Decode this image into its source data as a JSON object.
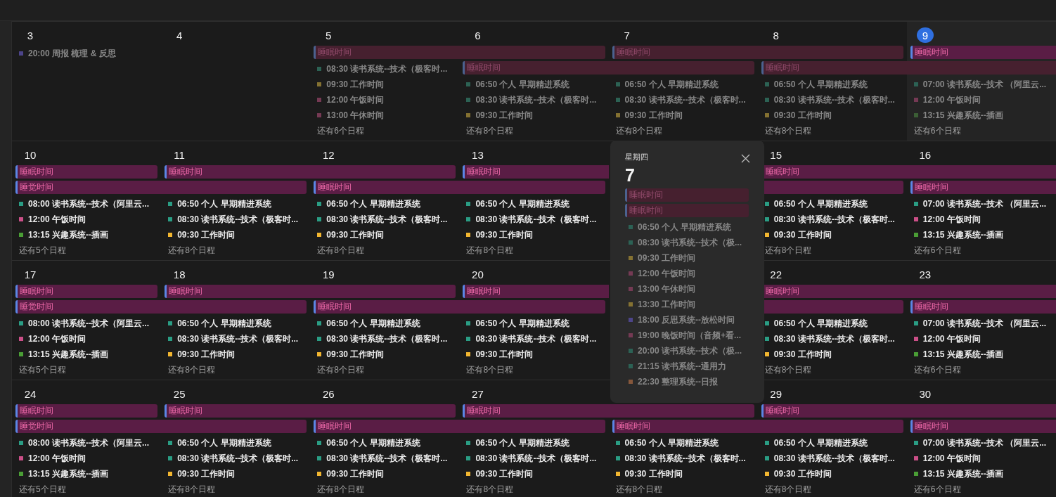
{
  "weeks": [
    {
      "days": [
        {
          "kind": "day",
          "day": "3",
          "today": false,
          "dimmed": true,
          "events": [
            {
              "text": "20:00 周报 梳理 & 反思",
              "color": "#4f4790"
            }
          ]
        },
        {
          "kind": "day",
          "day": "4",
          "today": false
        },
        {
          "kind": "day",
          "day": "5",
          "today": false,
          "dimmed": true,
          "lanes": [
            {
              "label": "睡眠时间",
              "starts": true,
              "ends": false,
              "dimmed": true
            }
          ],
          "events": [
            {
              "text": "08:30 读书系统--技术（极客时...",
              "color": "#2d6658"
            },
            {
              "text": "09:30 工作时间",
              "color": "#8a7633"
            },
            {
              "text": "12:00 午饭时间",
              "color": "#7a3b57"
            },
            {
              "text": "13:00 午休时间",
              "color": "#7a3b57"
            }
          ],
          "more": "还有6个日程"
        },
        {
          "kind": "day",
          "day": "6",
          "today": false,
          "dimmed": true,
          "lanes": [
            {
              "starts": false,
              "ends": true,
              "dimmed": true
            },
            {
              "label": "睡眠时间",
              "starts": true,
              "ends": false,
              "dimmed": true
            }
          ],
          "events": [
            {
              "text": "06:50 个人 早期精进系统",
              "color": "#2d6658"
            },
            {
              "text": "08:30 读书系统--技术（极客时...",
              "color": "#2d6658"
            },
            {
              "text": "09:30 工作时间",
              "color": "#8a7633"
            }
          ],
          "more": "还有8个日程"
        },
        {
          "kind": "day",
          "day": "7",
          "today": false,
          "dimmed": true,
          "lanes": [
            {
              "label": "睡眠时间",
              "starts": true,
              "ends": false,
              "dimmed": true
            },
            {
              "starts": false,
              "ends": true,
              "dimmed": true
            }
          ],
          "events": [
            {
              "text": "06:50 个人 早期精进系统",
              "color": "#2d6658"
            },
            {
              "text": "08:30 读书系统--技术（极客时...",
              "color": "#2d6658"
            },
            {
              "text": "09:30 工作时间",
              "color": "#8a7633"
            }
          ],
          "more": "还有8个日程"
        },
        {
          "kind": "day",
          "day": "8",
          "today": false,
          "dimmed": true,
          "lanes": [
            {
              "starts": false,
              "ends": true,
              "dimmed": true
            },
            {
              "label": "睡眠时间",
              "starts": true,
              "ends": false,
              "dimmed": true
            }
          ],
          "events": [
            {
              "text": "06:50 个人 早期精进系统",
              "color": "#2d6658"
            },
            {
              "text": "08:30 读书系统--技术（极客时...",
              "color": "#2d6658"
            },
            {
              "text": "09:30 工作时间",
              "color": "#8a7633"
            }
          ],
          "more": "还有8个日程"
        },
        {
          "kind": "day",
          "day": "9",
          "today": true,
          "dimmed": true,
          "lanes": [
            {
              "label": "睡眠时间",
              "starts": true,
              "ends": false,
              "dimmed": false
            },
            {
              "starts": false,
              "ends": false,
              "dimmed": true
            }
          ],
          "events": [
            {
              "text": "07:00 读书系统--技术 （阿里云...",
              "color": "#2d6658"
            },
            {
              "text": "12:00 午饭时间",
              "color": "#7a3b57"
            },
            {
              "text": "13:15 兴趣系统--插画",
              "color": "#3d6236"
            }
          ],
          "more": "还有6个日程"
        }
      ]
    },
    {
      "days": [
        {
          "kind": "day",
          "day": "10",
          "today": false,
          "dimmed": false,
          "lanes": [
            {
              "label": "睡眠时间",
              "starts": true,
              "ends": true,
              "dimmed": false
            },
            {
              "label": "睡觉时间",
              "starts": true,
              "ends": false,
              "dimmed": false
            }
          ],
          "events": [
            {
              "text": "08:00 读书系统--技术（阿里云...",
              "color": "#2a9d84"
            },
            {
              "text": "12:00 午饭时间",
              "color": "#cc4f88"
            },
            {
              "text": "13:15 兴趣系统--插画",
              "color": "#4a9e35"
            }
          ],
          "more": "还有5个日程"
        },
        {
          "kind": "day",
          "day": "11",
          "today": false,
          "dimmed": false,
          "lanes": [
            {
              "label": "睡眠时间",
              "starts": true,
              "ends": false,
              "dimmed": false
            },
            {
              "starts": false,
              "ends": true,
              "dimmed": false
            }
          ],
          "events": [
            {
              "text": "06:50 个人 早期精进系统",
              "color": "#2a9d84"
            },
            {
              "text": "08:30 读书系统--技术（极客时...",
              "color": "#2a9d84"
            },
            {
              "text": "09:30 工作时间",
              "color": "#f2b630"
            }
          ],
          "more": "还有8个日程"
        },
        {
          "kind": "day",
          "day": "12",
          "today": false,
          "dimmed": false,
          "lanes": [
            {
              "starts": false,
              "ends": true,
              "dimmed": false
            },
            {
              "label": "睡眠时间",
              "starts": true,
              "ends": false,
              "dimmed": false
            }
          ],
          "events": [
            {
              "text": "06:50 个人 早期精进系统",
              "color": "#2a9d84"
            },
            {
              "text": "08:30 读书系统--技术（极客时...",
              "color": "#2a9d84"
            },
            {
              "text": "09:30 工作时间",
              "color": "#f2b630"
            }
          ],
          "more": "还有8个日程"
        },
        {
          "kind": "day",
          "day": "13",
          "today": false,
          "dimmed": false,
          "lanes": [
            {
              "label": "睡眠时间",
              "starts": true,
              "ends": false,
              "dimmed": false
            },
            {
              "starts": false,
              "ends": true,
              "dimmed": false
            }
          ],
          "events": [
            {
              "text": "06:50 个人 早期精进系统",
              "color": "#2a9d84"
            },
            {
              "text": "08:30 读书系统--技术（极客时...",
              "color": "#2a9d84"
            },
            {
              "text": "09:30 工作时间",
              "color": "#f2b630"
            }
          ],
          "more": "还有8个日程"
        },
        {
          "kind": "covered"
        },
        {
          "kind": "day",
          "day": "15",
          "today": false,
          "dimmed": false,
          "lanes": [
            {
              "label": "睡眠时间",
              "starts": true,
              "ends": false,
              "dimmed": false
            },
            {
              "starts": false,
              "ends": true,
              "dimmed": false
            }
          ],
          "events": [
            {
              "text": "06:50 个人 早期精进系统",
              "color": "#2a9d84"
            },
            {
              "text": "08:30 读书系统--技术（极客时...",
              "color": "#2a9d84"
            },
            {
              "text": "09:30 工作时间",
              "color": "#f2b630"
            }
          ],
          "more": "还有8个日程"
        },
        {
          "kind": "day",
          "day": "16",
          "today": false,
          "dimmed": false,
          "lanes": [
            {
              "starts": false,
              "ends": false,
              "dimmed": false
            },
            {
              "label": "睡眠时间",
              "starts": true,
              "ends": false,
              "dimmed": false
            }
          ],
          "events": [
            {
              "text": "07:00 读书系统--技术 （阿里云...",
              "color": "#2a9d84"
            },
            {
              "text": "12:00 午饭时间",
              "color": "#cc4f88"
            },
            {
              "text": "13:15 兴趣系统--插画",
              "color": "#4a9e35"
            }
          ],
          "more": "还有6个日程"
        }
      ]
    },
    {
      "days": [
        {
          "kind": "day",
          "day": "17",
          "today": false,
          "dimmed": false,
          "lanes": [
            {
              "label": "睡眠时间",
              "starts": true,
              "ends": true,
              "dimmed": false
            },
            {
              "label": "睡觉时间",
              "starts": true,
              "ends": false,
              "dimmed": false
            }
          ],
          "events": [
            {
              "text": "08:00 读书系统--技术（阿里云...",
              "color": "#2a9d84"
            },
            {
              "text": "12:00 午饭时间",
              "color": "#cc4f88"
            },
            {
              "text": "13:15 兴趣系统--插画",
              "color": "#4a9e35"
            }
          ],
          "more": "还有5个日程"
        },
        {
          "kind": "day",
          "day": "18",
          "today": false,
          "dimmed": false,
          "lanes": [
            {
              "label": "睡眠时间",
              "starts": true,
              "ends": false,
              "dimmed": false
            },
            {
              "starts": false,
              "ends": true,
              "dimmed": false
            }
          ],
          "events": [
            {
              "text": "06:50 个人 早期精进系统",
              "color": "#2a9d84"
            },
            {
              "text": "08:30 读书系统--技术（极客时...",
              "color": "#2a9d84"
            },
            {
              "text": "09:30 工作时间",
              "color": "#f2b630"
            }
          ],
          "more": "还有8个日程"
        },
        {
          "kind": "day",
          "day": "19",
          "today": false,
          "dimmed": false,
          "lanes": [
            {
              "starts": false,
              "ends": true,
              "dimmed": false
            },
            {
              "label": "睡眠时间",
              "starts": true,
              "ends": false,
              "dimmed": false
            }
          ],
          "events": [
            {
              "text": "06:50 个人 早期精进系统",
              "color": "#2a9d84"
            },
            {
              "text": "08:30 读书系统--技术（极客时...",
              "color": "#2a9d84"
            },
            {
              "text": "09:30 工作时间",
              "color": "#f2b630"
            }
          ],
          "more": "还有8个日程"
        },
        {
          "kind": "day",
          "day": "20",
          "today": false,
          "dimmed": false,
          "lanes": [
            {
              "label": "睡眠时间",
              "starts": true,
              "ends": false,
              "dimmed": false
            },
            {
              "starts": false,
              "ends": true,
              "dimmed": false
            }
          ],
          "events": [
            {
              "text": "06:50 个人 早期精进系统",
              "color": "#2a9d84"
            },
            {
              "text": "08:30 读书系统--技术（极客时...",
              "color": "#2a9d84"
            },
            {
              "text": "09:30 工作时间",
              "color": "#f2b630"
            }
          ],
          "more": "还有8个日程"
        },
        {
          "kind": "covered"
        },
        {
          "kind": "day",
          "day": "22",
          "today": false,
          "dimmed": false,
          "lanes": [
            {
              "label": "睡眠时间",
              "starts": true,
              "ends": false,
              "dimmed": false
            },
            {
              "starts": false,
              "ends": true,
              "dimmed": false
            }
          ],
          "events": [
            {
              "text": "06:50 个人 早期精进系统",
              "color": "#2a9d84"
            },
            {
              "text": "08:30 读书系统--技术（极客时...",
              "color": "#2a9d84"
            },
            {
              "text": "09:30 工作时间",
              "color": "#f2b630"
            }
          ],
          "more": "还有8个日程"
        },
        {
          "kind": "day",
          "day": "23",
          "today": false,
          "dimmed": false,
          "lanes": [
            {
              "starts": false,
              "ends": false,
              "dimmed": false
            },
            {
              "label": "睡眠时间",
              "starts": true,
              "ends": false,
              "dimmed": false
            }
          ],
          "events": [
            {
              "text": "07:00 读书系统--技术 （阿里云...",
              "color": "#2a9d84"
            },
            {
              "text": "12:00 午饭时间",
              "color": "#cc4f88"
            },
            {
              "text": "13:15 兴趣系统--插画",
              "color": "#4a9e35"
            }
          ],
          "more": "还有6个日程"
        }
      ]
    },
    {
      "days": [
        {
          "kind": "day",
          "day": "24",
          "today": false,
          "dimmed": false,
          "lanes": [
            {
              "label": "睡眠时间",
              "starts": true,
              "ends": true,
              "dimmed": false
            },
            {
              "label": "睡觉时间",
              "starts": true,
              "ends": false,
              "dimmed": false
            }
          ],
          "events": [
            {
              "text": "08:00 读书系统--技术（阿里云...",
              "color": "#2a9d84"
            },
            {
              "text": "12:00 午饭时间",
              "color": "#cc4f88"
            },
            {
              "text": "13:15 兴趣系统--插画",
              "color": "#4a9e35"
            }
          ],
          "more": "还有5个日程"
        },
        {
          "kind": "day",
          "day": "25",
          "today": false,
          "dimmed": false,
          "lanes": [
            {
              "label": "睡眠时间",
              "starts": true,
              "ends": false,
              "dimmed": false
            },
            {
              "starts": false,
              "ends": true,
              "dimmed": false
            }
          ],
          "events": [
            {
              "text": "06:50 个人 早期精进系统",
              "color": "#2a9d84"
            },
            {
              "text": "08:30 读书系统--技术（极客时...",
              "color": "#2a9d84"
            },
            {
              "text": "09:30 工作时间",
              "color": "#f2b630"
            }
          ],
          "more": "还有8个日程"
        },
        {
          "kind": "day",
          "day": "26",
          "today": false,
          "dimmed": false,
          "lanes": [
            {
              "starts": false,
              "ends": true,
              "dimmed": false
            },
            {
              "label": "睡眠时间",
              "starts": true,
              "ends": false,
              "dimmed": false
            }
          ],
          "events": [
            {
              "text": "06:50 个人 早期精进系统",
              "color": "#2a9d84"
            },
            {
              "text": "08:30 读书系统--技术（极客时...",
              "color": "#2a9d84"
            },
            {
              "text": "09:30 工作时间",
              "color": "#f2b630"
            }
          ],
          "more": "还有8个日程"
        },
        {
          "kind": "day",
          "day": "27",
          "today": false,
          "dimmed": false,
          "lanes": [
            {
              "label": "睡眠时间",
              "starts": true,
              "ends": false,
              "dimmed": false
            },
            {
              "starts": false,
              "ends": true,
              "dimmed": false
            }
          ],
          "events": [
            {
              "text": "06:50 个人 早期精进系统",
              "color": "#2a9d84"
            },
            {
              "text": "08:30 读书系统--技术（极客时...",
              "color": "#2a9d84"
            },
            {
              "text": "09:30 工作时间",
              "color": "#f2b630"
            }
          ],
          "more": "还有8个日程"
        },
        {
          "kind": "day",
          "dimmed": false,
          "lanes": [
            {
              "starts": false,
              "ends": true,
              "dimmed": false
            },
            {
              "label": "睡眠时间",
              "starts": true,
              "ends": false,
              "dimmed": false
            }
          ],
          "events": [
            {
              "text": "06:50 个人 早期精进系统",
              "color": "#2a9d84"
            },
            {
              "text": "08:30 读书系统--技术（极客时...",
              "color": "#2a9d84"
            },
            {
              "text": "09:30 工作时间",
              "color": "#f2b630"
            }
          ],
          "more": "还有8个日程"
        },
        {
          "kind": "day",
          "day": "29",
          "today": false,
          "dimmed": false,
          "lanes": [
            {
              "label": "睡眠时间",
              "starts": true,
              "ends": false,
              "dimmed": false
            },
            {
              "starts": false,
              "ends": true,
              "dimmed": false
            }
          ],
          "events": [
            {
              "text": "06:50 个人 早期精进系统",
              "color": "#2a9d84"
            },
            {
              "text": "08:30 读书系统--技术（极客时...",
              "color": "#2a9d84"
            },
            {
              "text": "09:30 工作时间",
              "color": "#f2b630"
            }
          ],
          "more": "还有8个日程"
        },
        {
          "kind": "day",
          "day": "30",
          "today": false,
          "dimmed": false,
          "lanes": [
            {
              "starts": false,
              "ends": false,
              "dimmed": false
            },
            {
              "label": "睡眠时间",
              "starts": true,
              "ends": false,
              "dimmed": false
            }
          ],
          "events": [
            {
              "text": "07:00 读书系统--技术 （阿里云...",
              "color": "#2a9d84"
            },
            {
              "text": "12:00 午饭时间",
              "color": "#cc4f88"
            },
            {
              "text": "13:15 兴趣系统--插画",
              "color": "#4a9e35"
            }
          ],
          "more": "还有6个日程"
        }
      ]
    }
  ],
  "popup": {
    "weekday": "星期四",
    "day": "7",
    "lanes": [
      {
        "label": "睡眠时间",
        "dimmed": true
      },
      {
        "label": "睡眠时间",
        "dimmed": true
      }
    ],
    "events": [
      {
        "text": "06:50 个人 早期精进系统",
        "color": "#2d6658"
      },
      {
        "text": "08:30 读书系统--技术（极...",
        "color": "#2d6658"
      },
      {
        "text": "09:30 工作时间",
        "color": "#8a7633"
      },
      {
        "text": "12:00 午饭时间",
        "color": "#7a3b57"
      },
      {
        "text": "13:00 午休时间",
        "color": "#7a3b57"
      },
      {
        "text": "13:30 工作时间",
        "color": "#8a7633"
      },
      {
        "text": "18:00 反思系统--放松时间",
        "color": "#4f4790"
      },
      {
        "text": "19:00 晚饭时间（音频+看...",
        "color": "#7a3b57"
      },
      {
        "text": "20:00 读书系统--技术（极...",
        "color": "#2d6658"
      },
      {
        "text": "21:15 读书系统--通用力",
        "color": "#2d6658"
      },
      {
        "text": "22:30 整理系统--日报",
        "color": "#8b5a3c"
      }
    ]
  }
}
